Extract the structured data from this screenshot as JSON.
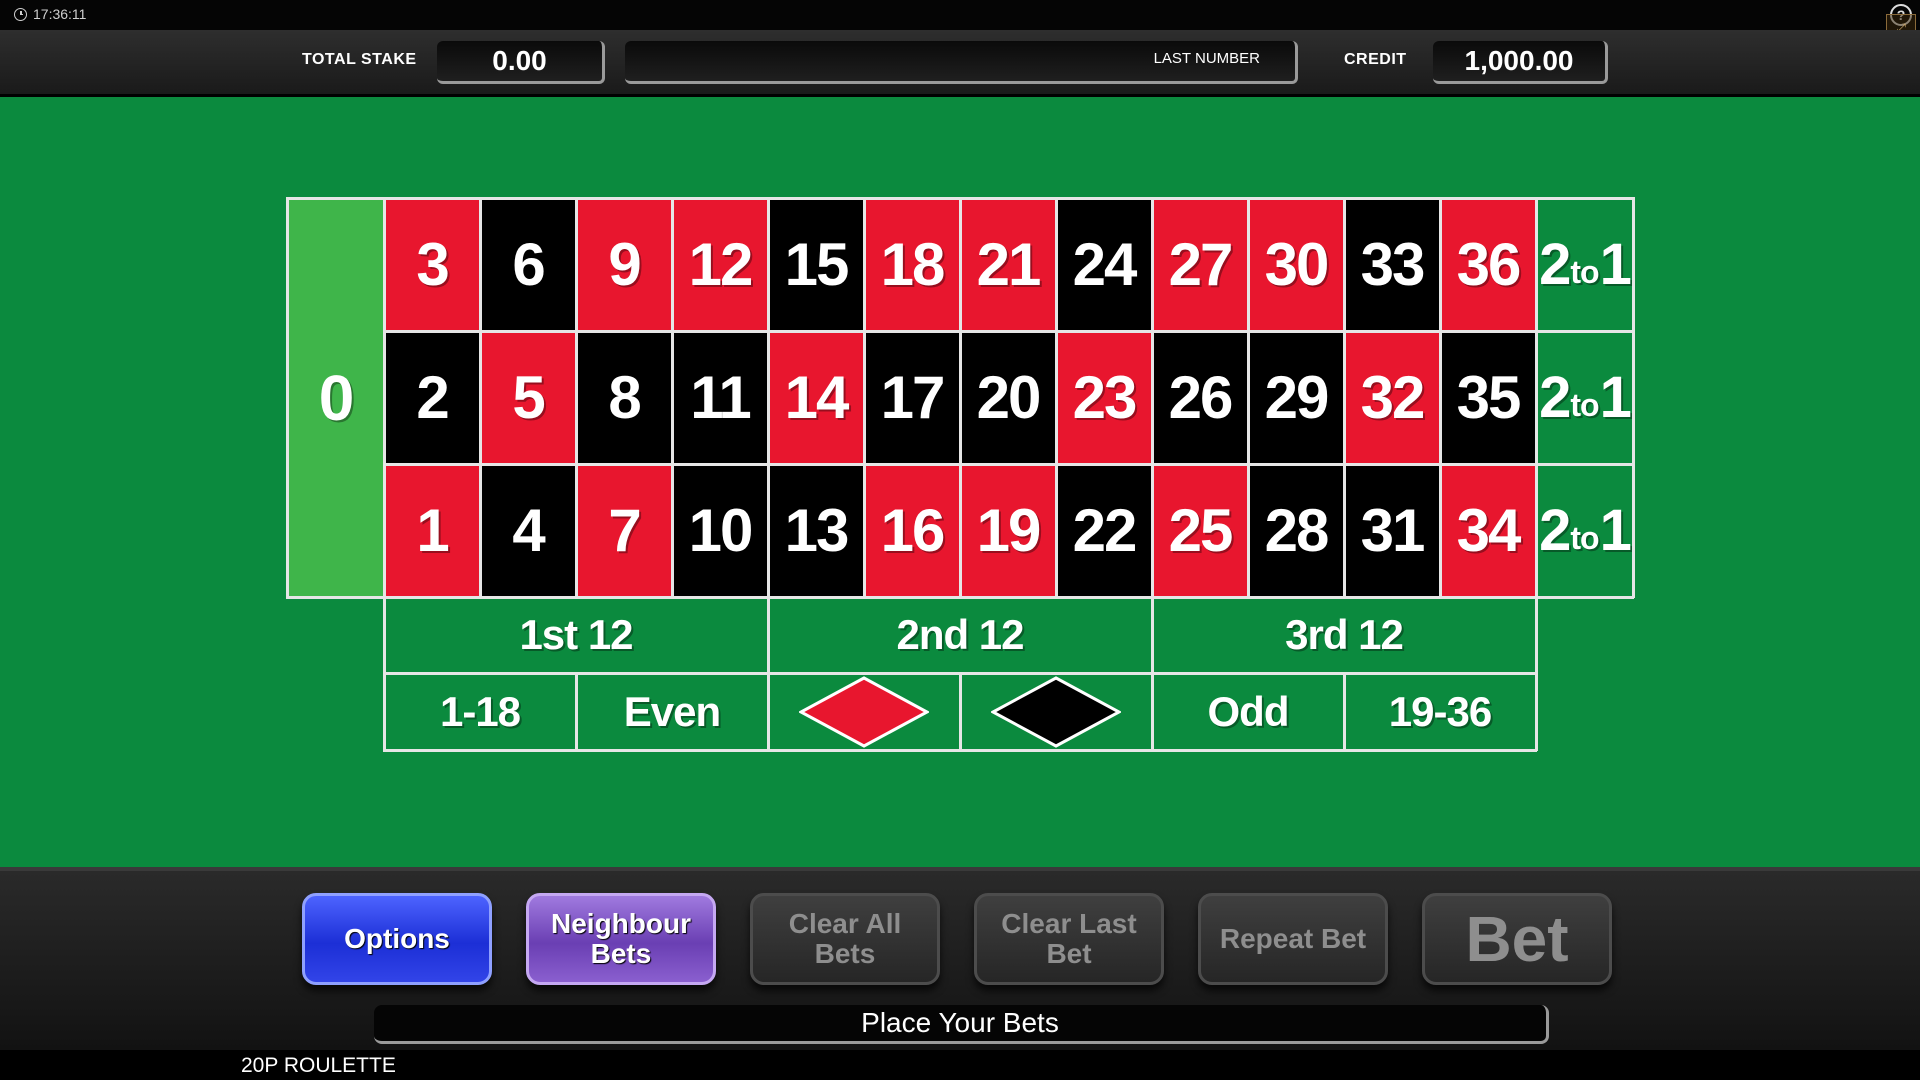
{
  "status_bar": {
    "clock": "17:36:11",
    "help_icon": "help-icon",
    "fullscreen_icon": "fullscreen-icon"
  },
  "top_bar": {
    "total_stake_label": "TOTAL STAKE",
    "total_stake_value": "0.00",
    "last_number_label": "LAST NUMBER",
    "credit_label": "CREDIT",
    "credit_value": "1,000.00"
  },
  "table": {
    "zero": "0",
    "rows": [
      [
        {
          "n": "3",
          "c": "red"
        },
        {
          "n": "6",
          "c": "black"
        },
        {
          "n": "9",
          "c": "red"
        },
        {
          "n": "12",
          "c": "red"
        },
        {
          "n": "15",
          "c": "black"
        },
        {
          "n": "18",
          "c": "red"
        },
        {
          "n": "21",
          "c": "red"
        },
        {
          "n": "24",
          "c": "black"
        },
        {
          "n": "27",
          "c": "red"
        },
        {
          "n": "30",
          "c": "red"
        },
        {
          "n": "33",
          "c": "black"
        },
        {
          "n": "36",
          "c": "red"
        }
      ],
      [
        {
          "n": "2",
          "c": "black"
        },
        {
          "n": "5",
          "c": "red"
        },
        {
          "n": "8",
          "c": "black"
        },
        {
          "n": "11",
          "c": "black"
        },
        {
          "n": "14",
          "c": "red"
        },
        {
          "n": "17",
          "c": "black"
        },
        {
          "n": "20",
          "c": "black"
        },
        {
          "n": "23",
          "c": "red"
        },
        {
          "n": "26",
          "c": "black"
        },
        {
          "n": "29",
          "c": "black"
        },
        {
          "n": "32",
          "c": "red"
        },
        {
          "n": "35",
          "c": "black"
        }
      ],
      [
        {
          "n": "1",
          "c": "red"
        },
        {
          "n": "4",
          "c": "black"
        },
        {
          "n": "7",
          "c": "red"
        },
        {
          "n": "10",
          "c": "black"
        },
        {
          "n": "13",
          "c": "black"
        },
        {
          "n": "16",
          "c": "red"
        },
        {
          "n": "19",
          "c": "red"
        },
        {
          "n": "22",
          "c": "black"
        },
        {
          "n": "25",
          "c": "red"
        },
        {
          "n": "28",
          "c": "black"
        },
        {
          "n": "31",
          "c": "black"
        },
        {
          "n": "34",
          "c": "red"
        }
      ]
    ],
    "column_bet": {
      "big": "2",
      "small": "to",
      "end": "1"
    },
    "dozens": [
      "1st 12",
      "2nd 12",
      "3rd 12"
    ],
    "outside": {
      "low": "1-18",
      "even": "Even",
      "red_icon": "red-diamond-icon",
      "black_icon": "black-diamond-icon",
      "odd": "Odd",
      "high": "19-36"
    },
    "colors": {
      "felt": "#0b8a3e",
      "red": "#e8162e",
      "black": "#000000",
      "zero": "#3fb54a"
    }
  },
  "buttons": {
    "options": "Options",
    "neighbour_bets_line1": "Neighbour",
    "neighbour_bets_line2": "Bets",
    "clear_all_line1": "Clear All",
    "clear_all_line2": "Bets",
    "clear_last_line1": "Clear Last",
    "clear_last_line2": "Bet",
    "repeat_bet": "Repeat Bet",
    "bet": "Bet"
  },
  "message": "Place Your Bets",
  "footer": {
    "game_title": "20P ROULETTE"
  }
}
